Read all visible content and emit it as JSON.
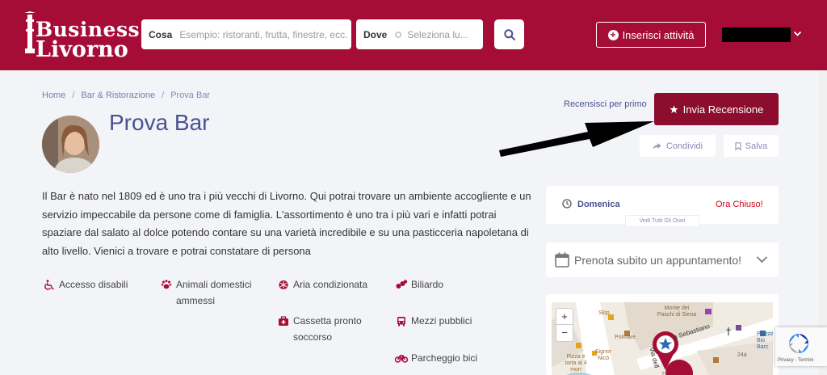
{
  "logo": {
    "line1": "Business",
    "line2": "Livorno"
  },
  "search": {
    "what_label": "Cosa",
    "what_placeholder": "Esempio: ristoranti, frutta, finestre, ecc.",
    "where_label": "Dove",
    "where_placeholder": "Seleziona lu..."
  },
  "header": {
    "add_business_label": "Inserisci attività"
  },
  "breadcrumb": [
    "Home",
    "Bar & Ristorazione",
    "Prova Bar"
  ],
  "listing": {
    "title": "Prova Bar",
    "description": "Il Bar è nato nel 1809 ed è uno tra i più vecchi di Livorno. Qui potrai trovare un ambiente accogliente e un servizio impeccabile da persone come di famiglia. L'assortimento è uno tra i più vari e infatti potrai spaziare dal salato al dolce potendo contare su una varietà incredibile e su una pasticceria napoletana di alto livello. Vienici a trovare e potrai constatare di persona"
  },
  "amenities": [
    {
      "label": "Accesso disabili",
      "icon": "wheelchair-icon"
    },
    {
      "label": "Animali domestici ammessi",
      "icon": "paw-icon"
    },
    {
      "label": "Aria condizionata",
      "icon": "snowflake-icon"
    },
    {
      "label": "Biliardo",
      "icon": "billiard-icon"
    },
    {
      "label": "Cassetta pronto soccorso",
      "icon": "first-aid-icon"
    },
    {
      "label": "Mezzi pubblici",
      "icon": "bus-icon"
    },
    {
      "label": "Parcheggio bici",
      "icon": "bicycle-icon"
    }
  ],
  "actions": {
    "review_prompt": "Recensisci per primo",
    "review_button": "Invia Recensione",
    "share_button": "Condividi",
    "save_button": "Salva"
  },
  "hours": {
    "day": "Domenica",
    "status": "Ora Chiuso!",
    "all_hours": "Vedi Tutti Gli Orari"
  },
  "booking": {
    "label": "Prenota subito un appuntamento!"
  },
  "map": {
    "zoom_in": "+",
    "zoom_out": "−",
    "labels": [
      "Skip",
      "Monte dei Paschi di Siena",
      "n Sebastiano",
      "Polmare",
      "Signor Nicò",
      "Pizza e torta al 4 mori",
      "Via dell",
      "Piazza Bio Barc",
      "24a",
      "21"
    ]
  },
  "recaptcha": {
    "text": "Privacy - Termini"
  },
  "colors": {
    "brand": "#a50d36",
    "accent": "#4a5290",
    "status_closed": "#d0021b"
  }
}
